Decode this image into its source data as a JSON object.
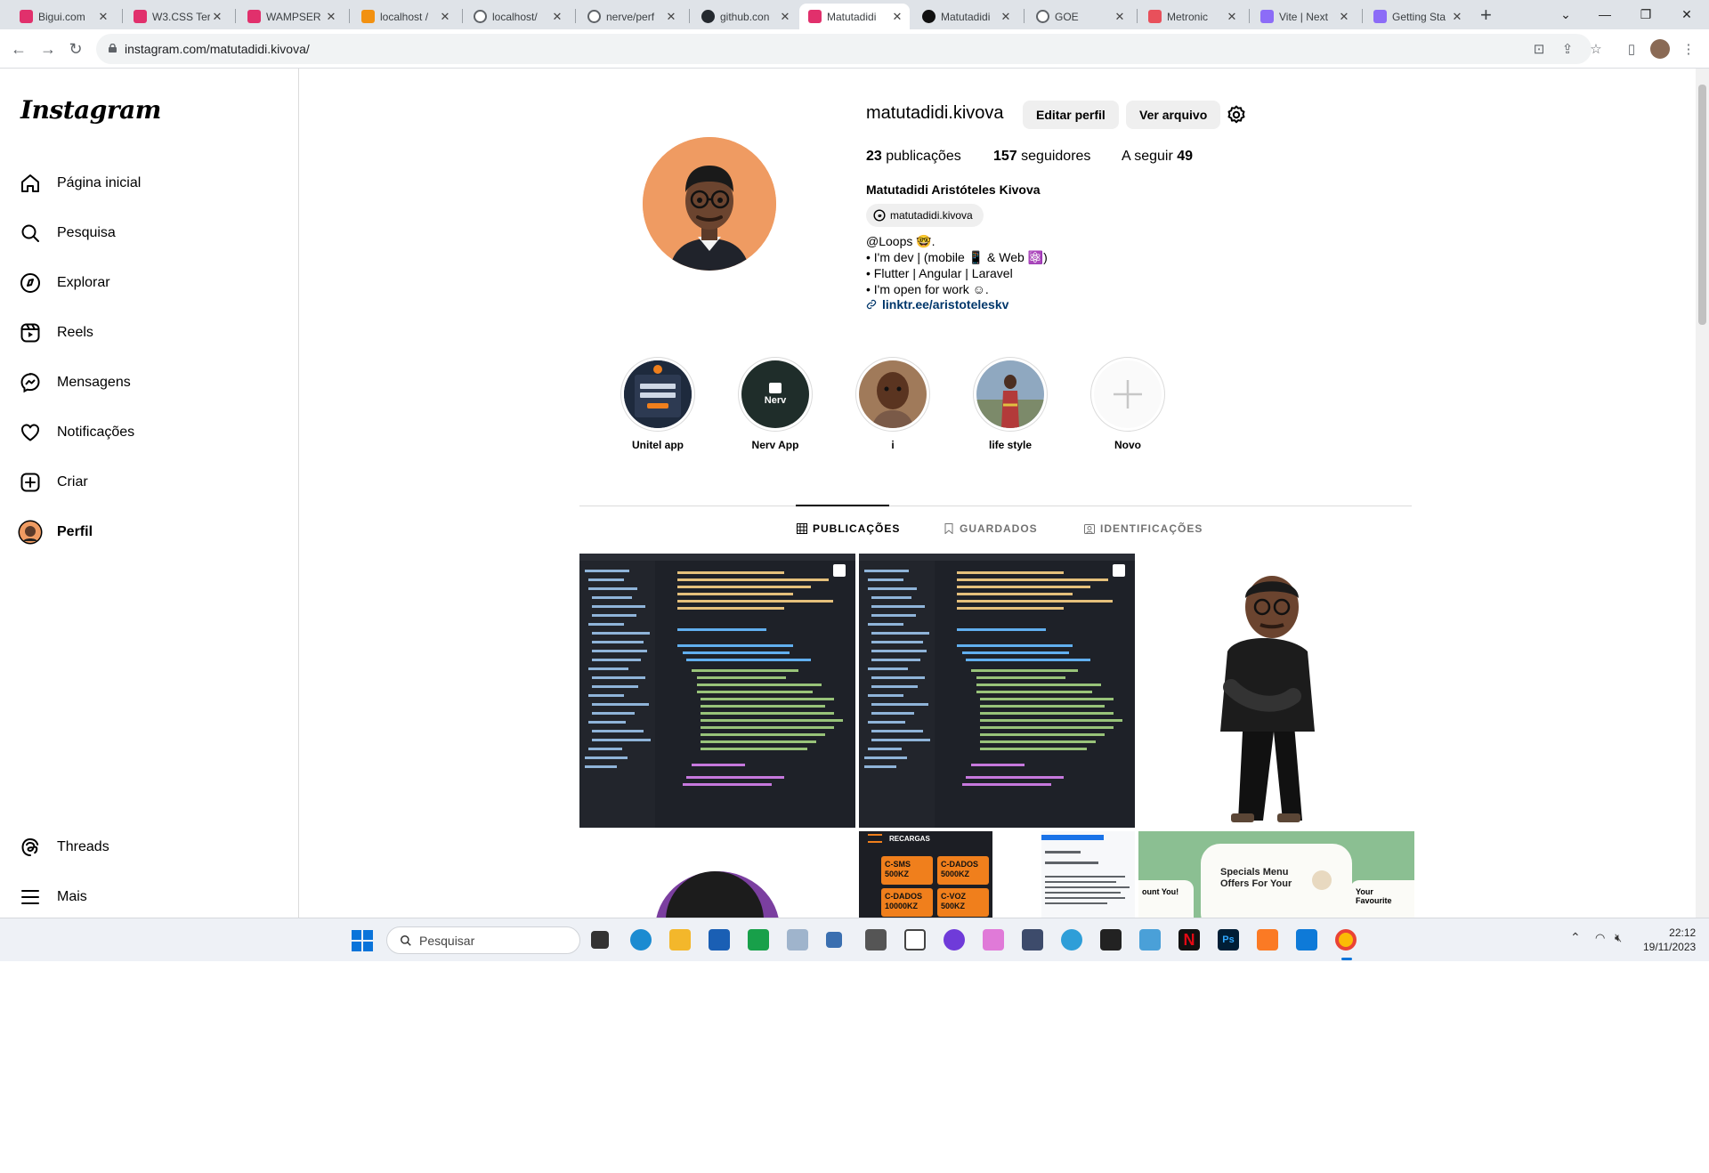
{
  "browser": {
    "tabs": [
      {
        "title": "Bigui.com",
        "color": "#e1306c"
      },
      {
        "title": "W3.CSS Ter",
        "color": "#e1306c"
      },
      {
        "title": "WAMPSER",
        "color": "#e1306c"
      },
      {
        "title": "localhost /",
        "color": "#f29111"
      },
      {
        "title": "localhost/",
        "color": "#5f6368"
      },
      {
        "title": "nerve/perf",
        "color": "#5f6368"
      },
      {
        "title": "github.con",
        "color": "#24292f"
      },
      {
        "title": "Matutadidi",
        "color": "#e1306c"
      },
      {
        "title": "Matutadidi",
        "color": "#111111"
      },
      {
        "title": "GOE",
        "color": "#5f6368"
      },
      {
        "title": "Metronic",
        "color": "#e8505b"
      },
      {
        "title": "Vite | Next",
        "color": "#8c6cf7"
      },
      {
        "title": "Getting Sta",
        "color": "#8c6cf7"
      }
    ],
    "url": "instagram.com/matutadidi.kivova/"
  },
  "sidebar": {
    "logo": "Instagram",
    "items": [
      {
        "label": "Página inicial",
        "icon": "home-icon"
      },
      {
        "label": "Pesquisa",
        "icon": "search-icon"
      },
      {
        "label": "Explorar",
        "icon": "compass-icon"
      },
      {
        "label": "Reels",
        "icon": "reels-icon"
      },
      {
        "label": "Mensagens",
        "icon": "messenger-icon"
      },
      {
        "label": "Notificações",
        "icon": "heart-icon"
      },
      {
        "label": "Criar",
        "icon": "plus-square-icon"
      },
      {
        "label": "Perfil",
        "icon": "avatar"
      }
    ],
    "bottom": [
      {
        "label": "Threads",
        "icon": "threads-icon"
      },
      {
        "label": "Mais",
        "icon": "menu-icon"
      }
    ]
  },
  "profile": {
    "username": "matutadidi.kivova",
    "edit_label": "Editar perfil",
    "archive_label": "Ver arquivo",
    "posts_count": "23",
    "posts_label": " publicações",
    "followers_count": "157",
    "followers_label": " seguidores",
    "following_label": "A seguir ",
    "following_count": "49",
    "full_name": "Matutadidi Aristóteles Kivova",
    "threads_handle": "matutadidi.kivova",
    "bio": [
      "@Loops 🤓.",
      "• I'm dev | (mobile 📱 & Web ⚛️)",
      "• Flutter | Angular | Laravel",
      "• I'm open for work ☺."
    ],
    "link": "linktr.ee/aristoteleskv"
  },
  "highlights": [
    {
      "label": "Unitel app"
    },
    {
      "label": "Nerv App",
      "text": "Nerv"
    },
    {
      "label": "i"
    },
    {
      "label": "life style"
    },
    {
      "label": "Novo"
    }
  ],
  "profile_tabs": [
    {
      "label": "PUBLICAÇÕES"
    },
    {
      "label": "GUARDADOS"
    },
    {
      "label": "IDENTIFICAÇÕES"
    }
  ],
  "posts": {
    "recargas_title": "RECARGAS",
    "recargas_tiles": [
      "C-SMS 500KZ",
      "C-DADOS 5000KZ",
      "C-DADOS 10000KZ",
      "C-VOZ 500KZ"
    ],
    "food_title": "Specials Menu Offers For Your",
    "food_left": "ount You!",
    "food_right": "Your Favourite"
  },
  "taskbar": {
    "search_placeholder": "Pesquisar",
    "time": "22:12",
    "date": "19/11/2023"
  }
}
